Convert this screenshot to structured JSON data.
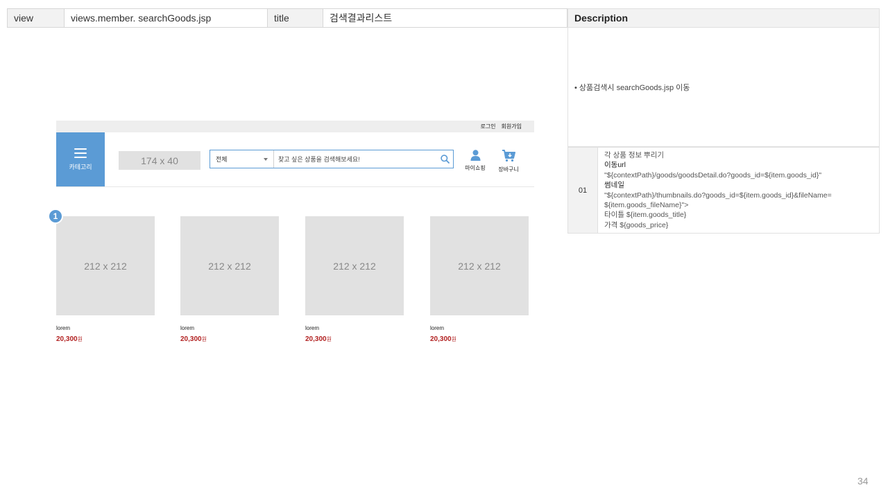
{
  "header": {
    "view_label": "view",
    "view_value": "views.member. searchGoods.jsp",
    "title_label": "title",
    "title_value": "검색결과리스트"
  },
  "description": {
    "heading": "Description",
    "bullet": "• 상품검색시 searchGoods.jsp  이동",
    "rows": [
      {
        "num": "01",
        "lines": [
          "각 상품 정보 뿌리기",
          "이동url",
          "\"${contextPath}/goods/goodsDetail.do?goods_id=${item.goods_id}\"",
          "썸네일",
          "\"${contextPath}/thumbnails.do?goods_id=${item.goods_id}&fileName=",
          "${item.goods_fileName}\">",
          "타이틀 ${item.goods_title}",
          "가격  ${goods_price}"
        ]
      }
    ]
  },
  "wireframe": {
    "topbar": {
      "login": "로그인",
      "signup": "회원가입"
    },
    "category_label": "카테고리",
    "logo_placeholder": "174 x 40",
    "search": {
      "select_value": "전체",
      "placeholder": "찾고 싶은 상품을 검색해보세요!"
    },
    "mypage_label": "마이쇼핑",
    "cart_label": "장바구니",
    "badge": "1",
    "products": [
      {
        "thumb": "212 x 212",
        "name": "lorem",
        "price": "20,300",
        "unit": "원"
      },
      {
        "thumb": "212 x 212",
        "name": "lorem",
        "price": "20,300",
        "unit": "원"
      },
      {
        "thumb": "212 x 212",
        "name": "lorem",
        "price": "20,300",
        "unit": "원"
      },
      {
        "thumb": "212 x 212",
        "name": "lorem",
        "price": "20,300",
        "unit": "원"
      }
    ]
  },
  "colors": {
    "accent": "#5b9bd5",
    "price": "#b22222",
    "placeholder": "#e1e1e1"
  },
  "page_number": "34"
}
